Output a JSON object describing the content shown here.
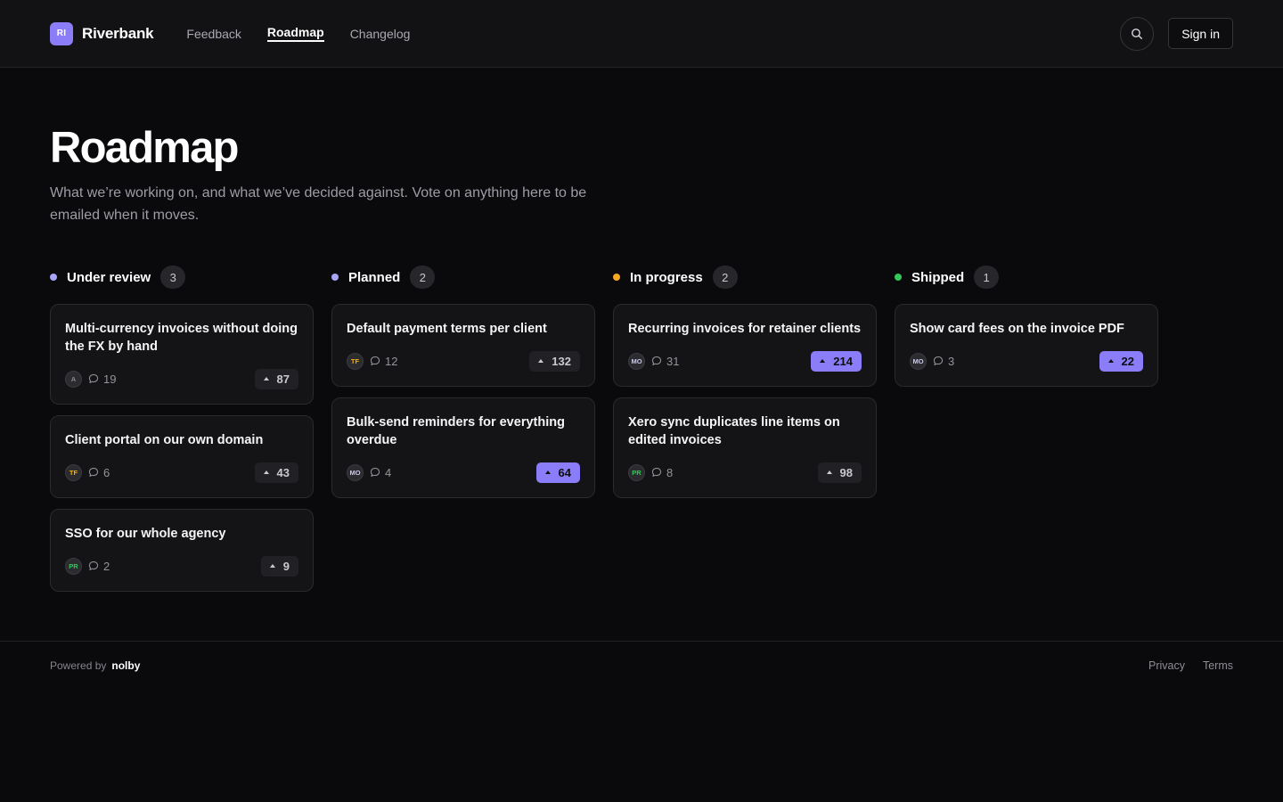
{
  "header": {
    "brand_initials": "RI",
    "brand_name": "Riverbank",
    "nav": [
      {
        "label": "Feedback",
        "active": false
      },
      {
        "label": "Roadmap",
        "active": true
      },
      {
        "label": "Changelog",
        "active": false
      }
    ],
    "search_icon": "search-icon",
    "signin_label": "Sign in"
  },
  "page": {
    "title": "Roadmap",
    "subtitle": "What we’re working on, and what we’ve decided against. Vote on anything here to be emailed when it moves."
  },
  "colors": {
    "accent": "#8b7cf8",
    "under_review": "#a9a4f5",
    "planned": "#a9a4f5",
    "in_progress": "#f5a623",
    "shipped": "#34c759"
  },
  "columns": [
    {
      "title": "Under review",
      "count": "3",
      "dot_color": "#a9a4f5",
      "cards": [
        {
          "title": "Multi-currency invoices without doing the FX by hand",
          "avatar": "A",
          "avatar_color": "#8a8a92",
          "comments": "19",
          "votes": "87",
          "voted": false
        },
        {
          "title": "Client portal on our own domain",
          "avatar": "TF",
          "avatar_color": "#f5b400",
          "comments": "6",
          "votes": "43",
          "voted": false
        },
        {
          "title": "SSO for our whole agency",
          "avatar": "PR",
          "avatar_color": "#34c759",
          "comments": "2",
          "votes": "9",
          "voted": false
        }
      ]
    },
    {
      "title": "Planned",
      "count": "2",
      "dot_color": "#a9a4f5",
      "cards": [
        {
          "title": "Default payment terms per client",
          "avatar": "TF",
          "avatar_color": "#f5b400",
          "comments": "12",
          "votes": "132",
          "voted": false
        },
        {
          "title": "Bulk-send reminders for everything overdue",
          "avatar": "MO",
          "avatar_color": "#c9c9f0",
          "comments": "4",
          "votes": "64",
          "voted": true
        }
      ]
    },
    {
      "title": "In progress",
      "count": "2",
      "dot_color": "#f5a623",
      "cards": [
        {
          "title": "Recurring invoices for retainer clients",
          "avatar": "MO",
          "avatar_color": "#c9c9f0",
          "comments": "31",
          "votes": "214",
          "voted": true
        },
        {
          "title": "Xero sync duplicates line items on edited invoices",
          "avatar": "PR",
          "avatar_color": "#34c759",
          "comments": "8",
          "votes": "98",
          "voted": false
        }
      ]
    },
    {
      "title": "Shipped",
      "count": "1",
      "dot_color": "#34c759",
      "cards": [
        {
          "title": "Show card fees on the invoice PDF",
          "avatar": "MO",
          "avatar_color": "#c9c9f0",
          "comments": "3",
          "votes": "22",
          "voted": true
        }
      ]
    }
  ],
  "footer": {
    "powered_label": "Powered by",
    "powered_brand": "nolby",
    "links": [
      "Privacy",
      "Terms"
    ]
  }
}
